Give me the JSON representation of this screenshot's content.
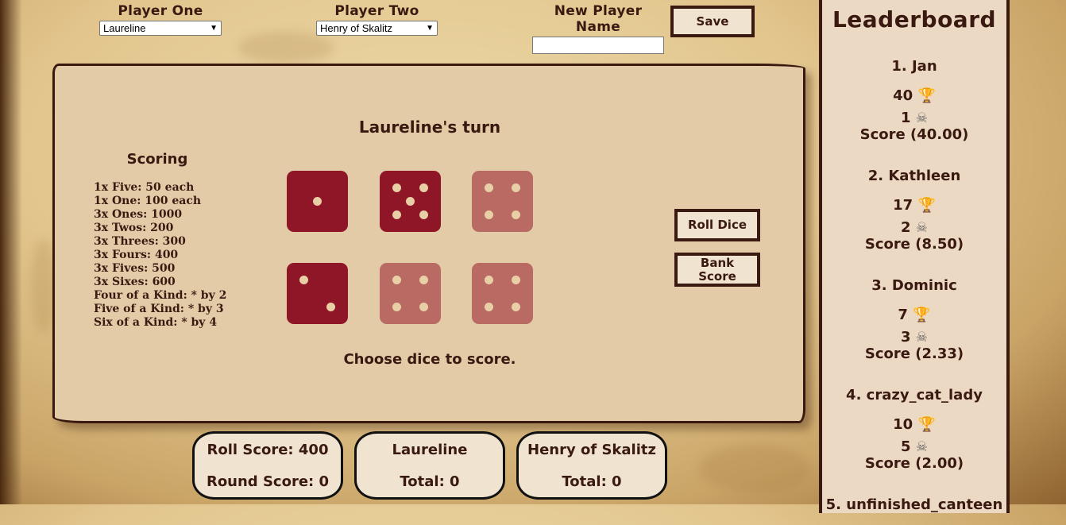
{
  "header": {
    "player_one_label": "Player One",
    "player_one_value": "Laureline",
    "player_two_label": "Player Two",
    "player_two_value": "Henry of Skalitz",
    "new_player_label": "New Player Name",
    "new_player_value": "",
    "save_label": "Save"
  },
  "board": {
    "turn_title": "Laureline's turn",
    "scoring_title": "Scoring",
    "rules": [
      "1x Five: 50 each",
      "1x One: 100 each",
      "3x Ones: 1000",
      "3x Twos: 200",
      "3x Threes: 300",
      "3x Fours: 400",
      "3x Fives: 500",
      "3x Sixes: 600",
      "Four of a Kind: * by 2",
      "Five of a Kind: * by 3",
      "Six of a Kind: * by 4"
    ],
    "dice": [
      {
        "face": 1,
        "state": "active"
      },
      {
        "face": 5,
        "state": "active"
      },
      {
        "face": 4,
        "state": "selected"
      },
      {
        "face": 2,
        "state": "active"
      },
      {
        "face": 4,
        "state": "selected"
      },
      {
        "face": 4,
        "state": "selected"
      }
    ],
    "roll_dice_label": "Roll Dice",
    "bank_score_label": "Bank Score",
    "status": "Choose dice to score."
  },
  "scoreboard": {
    "roll_score": "Roll Score: 400",
    "round_score": "Round Score: 0",
    "player_one_name": "Laureline",
    "player_one_total": "Total: 0",
    "player_two_name": "Henry of Skalitz",
    "player_two_total": "Total: 0"
  },
  "leaderboard": {
    "title": "Leaderboard",
    "entries": [
      {
        "name": "1. Jan",
        "wins": "40",
        "losses": "1",
        "score": "Score (40.00)"
      },
      {
        "name": "2. Kathleen",
        "wins": "17",
        "losses": "2",
        "score": "Score (8.50)"
      },
      {
        "name": "3. Dominic",
        "wins": "7",
        "losses": "3",
        "score": "Score (2.33)"
      },
      {
        "name": "4. crazy_cat_lady",
        "wins": "10",
        "losses": "5",
        "score": "Score (2.00)"
      },
      {
        "name": "5. unfinished_canteen",
        "wins": "",
        "losses": "",
        "score": ""
      }
    ],
    "icons": {
      "wins": "trophy-icon",
      "losses": "skull-icon"
    }
  },
  "colors": {
    "die_active": "#8f1626",
    "die_selected": "#b86a63",
    "ink": "#3a1a10",
    "panel": "#e3cba7"
  }
}
